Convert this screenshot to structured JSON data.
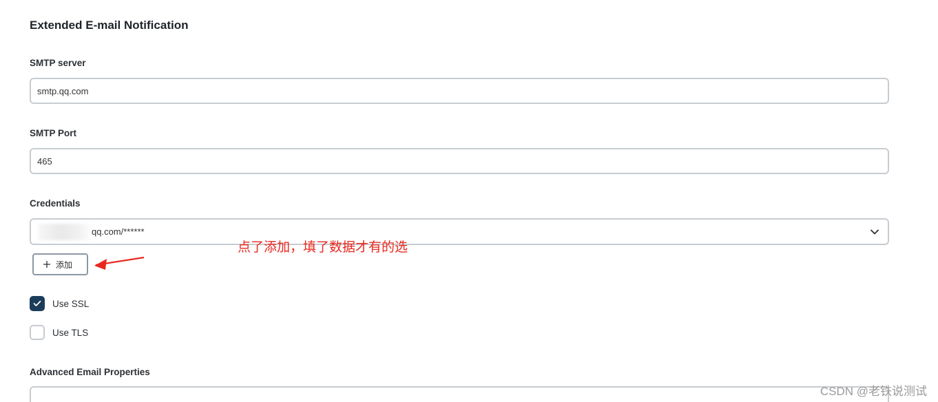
{
  "section_title": "Extended E-mail Notification",
  "smtp_server": {
    "label": "SMTP server",
    "value": "smtp.qq.com"
  },
  "smtp_port": {
    "label": "SMTP Port",
    "value": "465"
  },
  "credentials": {
    "label": "Credentials",
    "selected_value": "qq.com/******",
    "add_button_label": "添加"
  },
  "use_ssl": {
    "label": "Use SSL",
    "checked": true
  },
  "use_tls": {
    "label": "Use TLS",
    "checked": false
  },
  "advanced_email_properties": {
    "label": "Advanced Email Properties",
    "value": ""
  },
  "annotation": {
    "text": "点了添加，填了数据才有的选",
    "color": "#e8281e"
  },
  "watermark": "CSDN @老铁说测试",
  "colors": {
    "checkbox_checked": "#1c3d5a",
    "input_border": "#c7ccd1"
  },
  "icons": {
    "chevron": "chevron-down-icon",
    "plus": "plus-icon",
    "check": "check-icon",
    "arrow": "arrow-left-icon"
  }
}
